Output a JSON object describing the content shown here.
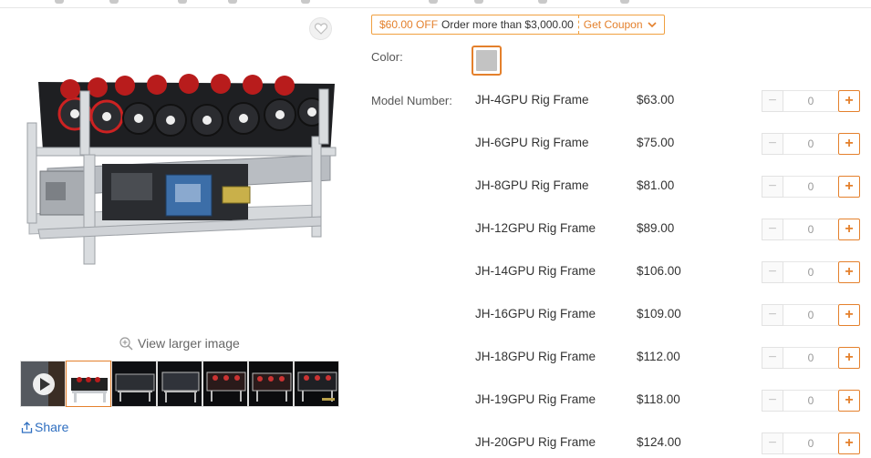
{
  "colors": {
    "accent": "#e4802c",
    "link": "#2e6ec0",
    "swatch": "#c3c3c3"
  },
  "gallery": {
    "favorite_icon": "heart-icon",
    "view_larger_icon": "zoom-in-icon",
    "view_larger_label": "View larger image",
    "share_icon": "share-icon",
    "share_label": "Share",
    "thumbnails": [
      {
        "kind": "video",
        "icon": "play-icon"
      },
      {
        "kind": "image",
        "active": true
      },
      {
        "kind": "image"
      },
      {
        "kind": "image"
      },
      {
        "kind": "image"
      },
      {
        "kind": "image"
      },
      {
        "kind": "image"
      }
    ]
  },
  "coupon": {
    "discount": "$60.00 OFF",
    "condition": "Order more than $3,000.00",
    "action": "Get Coupon",
    "action_icon": "chevron-down-icon"
  },
  "color": {
    "label": "Color:",
    "selected_swatch": "silver"
  },
  "model": {
    "label": "Model Number:",
    "items": [
      {
        "name": "JH-4GPU Rig Frame",
        "price": "$63.00",
        "qty": "0"
      },
      {
        "name": "JH-6GPU Rig Frame",
        "price": "$75.00",
        "qty": "0"
      },
      {
        "name": "JH-8GPU Rig Frame",
        "price": "$81.00",
        "qty": "0"
      },
      {
        "name": "JH-12GPU Rig Frame",
        "price": "$89.00",
        "qty": "0"
      },
      {
        "name": "JH-14GPU Rig Frame",
        "price": "$106.00",
        "qty": "0"
      },
      {
        "name": "JH-16GPU Rig Frame",
        "price": "$109.00",
        "qty": "0"
      },
      {
        "name": "JH-18GPU Rig Frame",
        "price": "$112.00",
        "qty": "0"
      },
      {
        "name": "JH-19GPU Rig Frame",
        "price": "$118.00",
        "qty": "0"
      },
      {
        "name": "JH-20GPU Rig Frame",
        "price": "$124.00",
        "qty": "0"
      }
    ],
    "minus_symbol": "−",
    "plus_symbol": "+"
  }
}
